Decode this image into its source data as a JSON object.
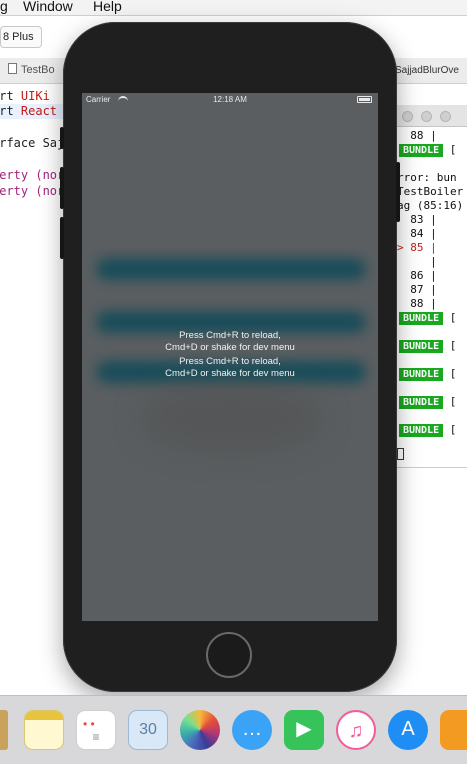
{
  "menubar": {
    "items": [
      "g",
      "Window",
      "Help"
    ]
  },
  "toolbar": {
    "scheme": "8 Plus"
  },
  "tabs": {
    "left": "TestBo",
    "right": "SajjadBlurOve"
  },
  "editor": {
    "lines": [
      {
        "pre": "ort <",
        "tok": "UIKi",
        "kind": "str"
      },
      {
        "pre": "ort <",
        "tok": "React",
        "kind": "str"
      },
      {
        "pre": "",
        "tok": "erface Saj",
        "kind": "plain"
      },
      {
        "pre": "",
        "tok": "perty (nor",
        "kind": "kw"
      },
      {
        "pre": "",
        "tok": "perty (nor",
        "kind": "kw"
      }
    ]
  },
  "terminal": {
    "lines": [
      "  88 |",
      "BUNDLE",
      "rror: bun",
      "TestBoiler",
      "ag (85:16)",
      "  83 |",
      "  84 |",
      "> 85 |",
      "     |",
      "  86 |",
      "  87 |",
      "  88 |"
    ],
    "badge": "BUNDLE",
    "bracket": "[",
    "badge_rows": 6
  },
  "simulator": {
    "carrier": "Carrier",
    "time": "12:18 AM",
    "message": {
      "line1": "Press Cmd+R to reload,",
      "line2": "Cmd+D or shake for dev menu"
    }
  },
  "dock": {
    "apps": [
      "Notes",
      "Reminders",
      "Preview",
      "Photos",
      "Messages",
      "FaceTime",
      "iTunes",
      "App Store",
      "iBooks"
    ],
    "glyphs": {
      "messages": "…",
      "facetime": "▶",
      "itunes": "♫",
      "appstore": "A",
      "preview": "30"
    }
  }
}
